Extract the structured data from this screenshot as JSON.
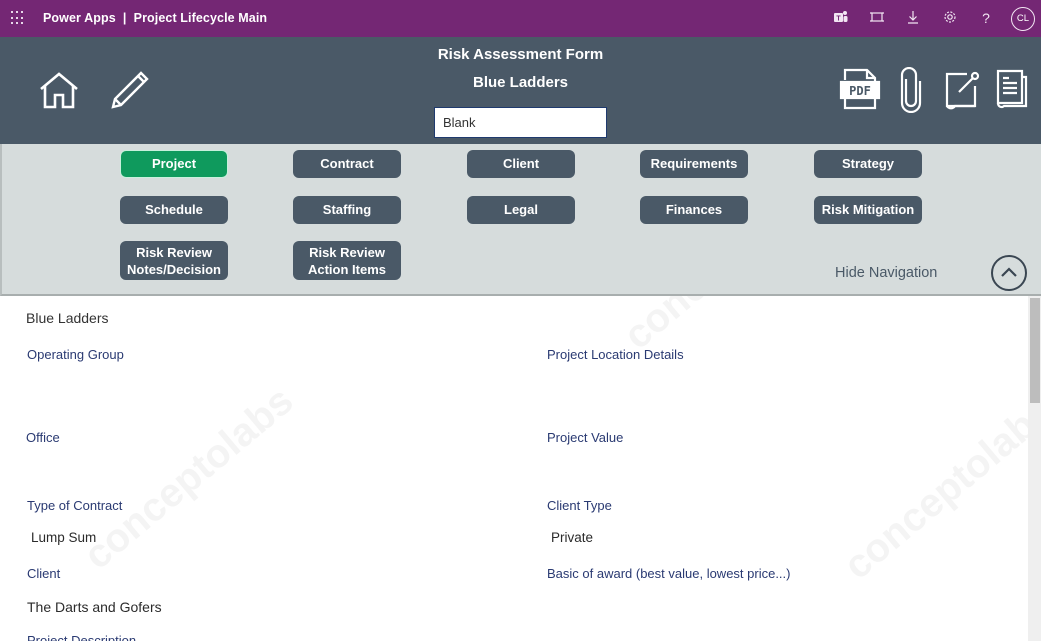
{
  "app_bar": {
    "title": "Power Apps  |  Project Lifecycle Main",
    "icons": [
      "app-launcher-icon",
      "teams-icon",
      "fit-screen-icon",
      "download-icon",
      "settings-icon",
      "help-icon"
    ],
    "help_glyph": "?",
    "user_initials": "CL"
  },
  "header": {
    "form_title": "Risk Assessment Form",
    "project_name": "Blue Ladders",
    "status_input_value": "Blank",
    "left_icons": [
      "home-icon",
      "edit-pencil-icon"
    ],
    "right_icons": [
      "pdf-icon",
      "attachment-icon",
      "note-icon",
      "document-icon"
    ],
    "pdf_label": "PDF"
  },
  "navigation": {
    "buttons": [
      {
        "label": "Project",
        "active": true
      },
      {
        "label": "Contract",
        "active": false
      },
      {
        "label": "Client",
        "active": false
      },
      {
        "label": "Requirements",
        "active": false
      },
      {
        "label": "Strategy",
        "active": false
      },
      {
        "label": "Schedule",
        "active": false
      },
      {
        "label": "Staffing",
        "active": false
      },
      {
        "label": "Legal",
        "active": false
      },
      {
        "label": "Finances",
        "active": false
      },
      {
        "label": "Risk Mitigation",
        "active": false
      },
      {
        "label_line1": "Risk Review",
        "label_line2": "Notes/Decision",
        "active": false
      },
      {
        "label_line1": "Risk Review",
        "label_line2": "Action Items",
        "active": false
      }
    ],
    "hide_label": "Hide Navigation",
    "active_color": "#0f9a5d",
    "button_color": "#4a5967"
  },
  "form": {
    "record_title": "Blue Ladders",
    "fields": [
      {
        "label": "Operating Group",
        "value": ""
      },
      {
        "label": "Project Location Details",
        "value": ""
      },
      {
        "label": "Office",
        "value": ""
      },
      {
        "label": "Project Value",
        "value": ""
      },
      {
        "label": "Type of Contract",
        "value": "Lump Sum"
      },
      {
        "label": "Client Type",
        "value": "Private"
      },
      {
        "label": "Client",
        "value": "The Darts and Gofers"
      },
      {
        "label": "Basic of award (best value, lowest price...)",
        "value": ""
      },
      {
        "label": "Project Description",
        "value": ""
      }
    ]
  },
  "watermark": "conceptolabs"
}
